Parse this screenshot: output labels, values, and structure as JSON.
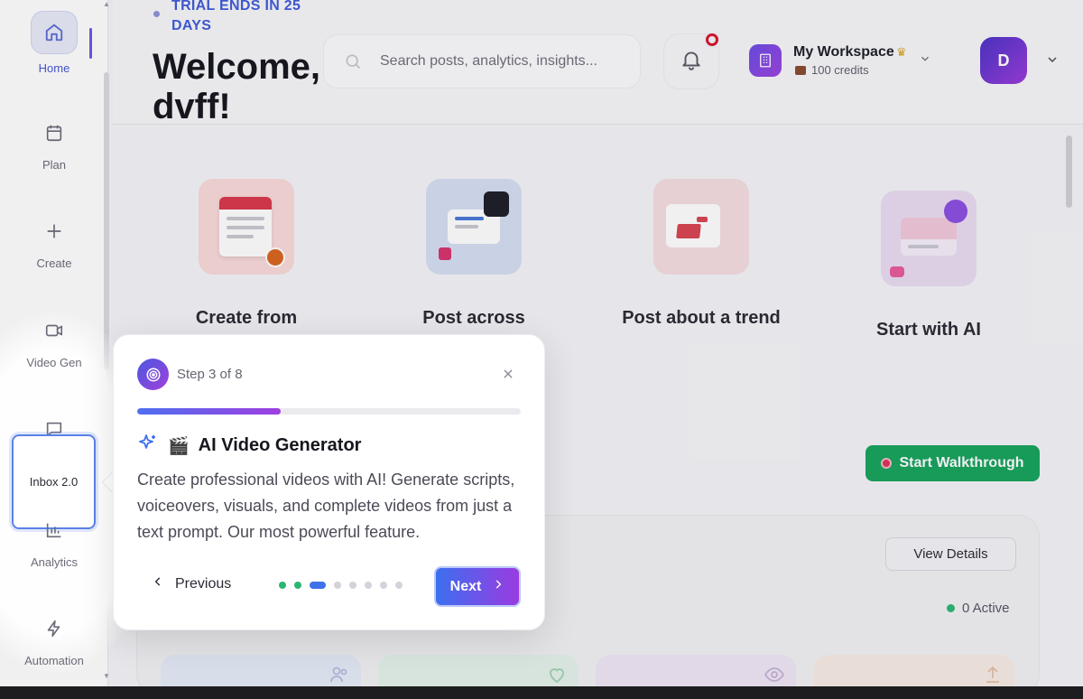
{
  "sidebar": {
    "items": [
      {
        "label": "Home",
        "icon": "home-icon"
      },
      {
        "label": "Plan",
        "icon": "calendar-icon"
      },
      {
        "label": "Create",
        "icon": "plus-icon"
      },
      {
        "label": "Video Gen",
        "icon": "video-icon"
      },
      {
        "label": "Inbox 2.0",
        "icon": "message-icon"
      },
      {
        "label": "Analytics",
        "icon": "bar-chart-icon"
      },
      {
        "label": "Automation",
        "icon": "lightning-icon"
      }
    ]
  },
  "header": {
    "trial": "TRIAL ENDS IN 25 DAYS",
    "welcome": "Welcome, dvff!",
    "search_placeholder": "Search posts, analytics, insights...",
    "workspace_name": "My Workspace",
    "workspace_credits": "100 credits",
    "avatar_initial": "D"
  },
  "cards": [
    {
      "title": "Create from"
    },
    {
      "title": "Post across"
    },
    {
      "title": "Post about a trend"
    },
    {
      "title": "Start with AI"
    }
  ],
  "walkthrough_label": "Start Walkthrough",
  "panel": {
    "view_details": "View Details",
    "active": "0 Active"
  },
  "tour": {
    "step": "Step 3 of 8",
    "progress": 0.375,
    "emoji": "🎬",
    "title": "AI Video Generator",
    "body": "Create professional videos with AI! Generate scripts, voiceovers, visuals, and complete videos from just a text prompt. Our most powerful feature.",
    "previous": "Previous",
    "next": "Next",
    "total_steps": 8,
    "current_step": 3
  },
  "colors": {
    "accent": "#3f5bd8",
    "success": "#17a35c",
    "brand_gradient_start": "#3c6ff0",
    "brand_gradient_end": "#9a3be0"
  }
}
